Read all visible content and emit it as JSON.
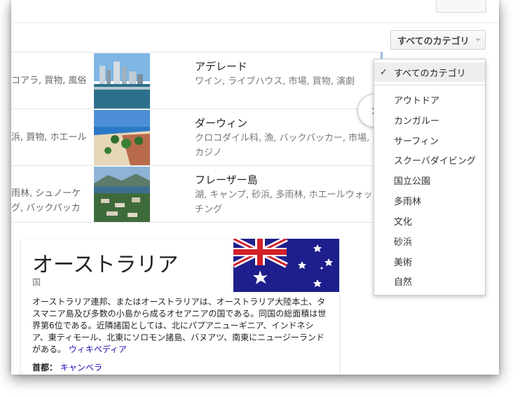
{
  "category_button": {
    "label": "すべてのカテゴリ"
  },
  "rows": [
    {
      "left_text": "コアラ, 買物, 風俗",
      "title": "アデレード",
      "subtitle": "ワイン, ライブハウス, 市場, 買物, 演劇"
    },
    {
      "left_text": "浜, 買物, ホエール",
      "title": "ダーウィン",
      "subtitle": "クロコダイル科, 漁, バックパッカー, 市場, カジノ"
    },
    {
      "left_text_1": "雨林, シュノーケ",
      "left_text_2": "グ, バックパッカ",
      "title": "フレーザー島",
      "subtitle": "湖, キャンプ, 砂浜, 多雨林, ホエールウォッチング"
    }
  ],
  "arrow": {
    "symbol": "›"
  },
  "dropdown": {
    "selected": "すべてのカテゴリ",
    "check": "✓",
    "items": [
      "アウトドア",
      "カンガルー",
      "サーフィン",
      "スクーバダイビング",
      "国立公園",
      "多雨林",
      "文化",
      "砂浜",
      "美術",
      "自然"
    ]
  },
  "knowledge_panel": {
    "title": "オーストラリア",
    "subtitle": "国",
    "description": "オーストラリア連邦、またはオーストラリアは、オーストラリア大陸本土、タスマニア島及び多数の小島から成るオセアニアの国である。同国の総面積は世界第6位である。近隣諸国としては、北にパプアニューギニア、インドネシア、東ティモール、北東にソロモン諸島、バヌアツ、南東にニュージーランドがある。",
    "source_link": "ウィキペディア",
    "capital_label": "首都：",
    "capital_value": "キャンベラ",
    "flag_colors": {
      "blue": "#1e1e8c",
      "red": "#d4202a",
      "white": "#ffffff"
    }
  }
}
